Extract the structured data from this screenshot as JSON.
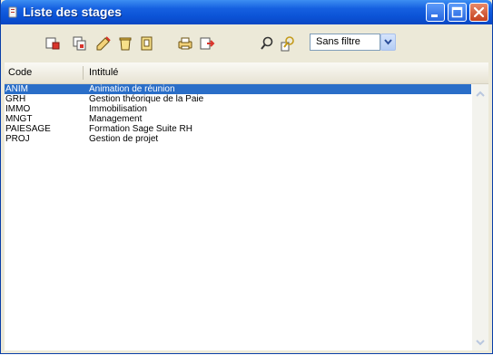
{
  "window": {
    "title": "Liste des stages"
  },
  "toolbar": {
    "icons": [
      "new-record-icon",
      "copy-record-icon",
      "edit-record-icon",
      "delete-record-icon",
      "open-file-icon",
      "print-icon",
      "export-icon",
      "search-icon",
      "search-filter-icon"
    ],
    "filter_value": "Sans filtre"
  },
  "table": {
    "columns": [
      "Code",
      "Intitulé"
    ],
    "rows": [
      {
        "code": "ANIM",
        "label": "Animation de réunion",
        "selected": true
      },
      {
        "code": "GRH",
        "label": "Gestion théorique de la Paie",
        "selected": false
      },
      {
        "code": "IMMO",
        "label": "Immobilisation",
        "selected": false
      },
      {
        "code": "MNGT",
        "label": "Management",
        "selected": false
      },
      {
        "code": "PAIESAGE",
        "label": "Formation Sage Suite RH",
        "selected": false
      },
      {
        "code": "PROJ",
        "label": "Gestion de projet",
        "selected": false
      }
    ]
  },
  "colors": {
    "titlebar": "#0b52d6",
    "selection": "#2a6ec8",
    "window_bg": "#ece9d8"
  }
}
